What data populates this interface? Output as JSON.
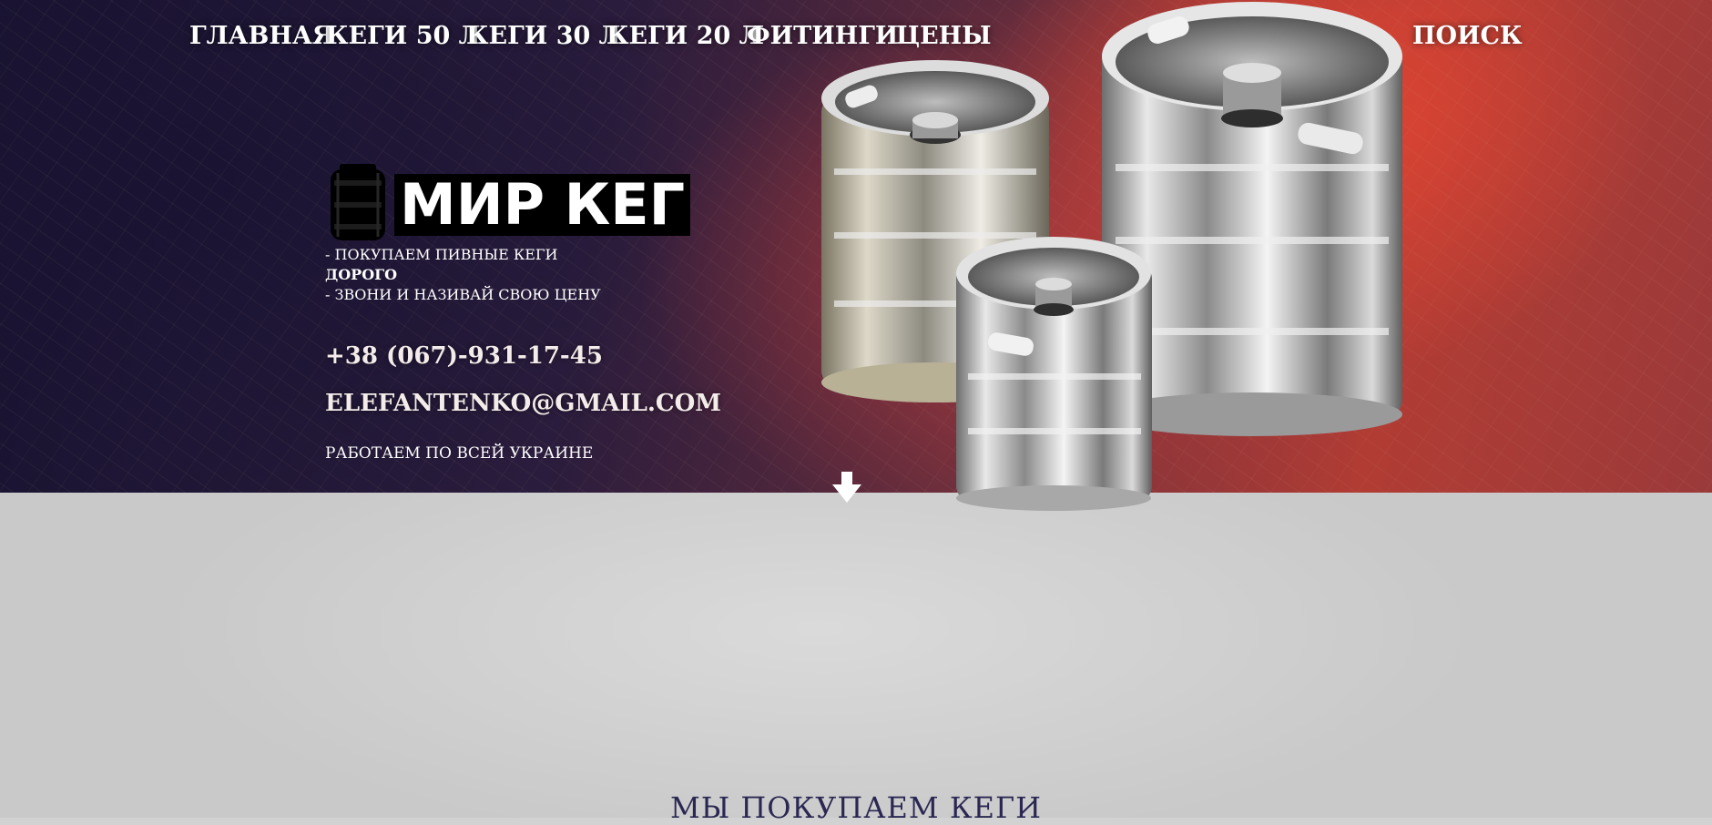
{
  "nav": {
    "items": [
      {
        "label": "ГЛАВНАЯ"
      },
      {
        "label": "КЕГИ 50 Л"
      },
      {
        "label": "КЕГИ 30 Л"
      },
      {
        "label": "КЕГИ 20 Л"
      },
      {
        "label": "ФИТИНГИ"
      },
      {
        "label": "ЦЕНЫ"
      }
    ],
    "search_label": "ПОИСК"
  },
  "brand": {
    "name": "МИР КЕГ",
    "icon": "keg-icon"
  },
  "taglines": [
    "- ПОКУПАЕМ ПИВНЫЕ КЕГИ",
    "ДОРОГО",
    "- ЗВОНИ И НАЗИВАЙ СВОЮ ЦЕНУ"
  ],
  "contact": {
    "phone": "+38 (067)-931-17-45",
    "email": "ELEFANTENKO@GMAIL.COM",
    "coverage": "РАБОТАЕМ ПО ВСЕЙ УКРАИНЕ"
  },
  "section": {
    "title": "МЫ ПОКУПАЕМ КЕГИ"
  },
  "colors": {
    "hero_dark": "#181330",
    "hero_red": "#b13c34",
    "section_title": "#2a2752",
    "lower_bg": "#d2d2d2"
  }
}
